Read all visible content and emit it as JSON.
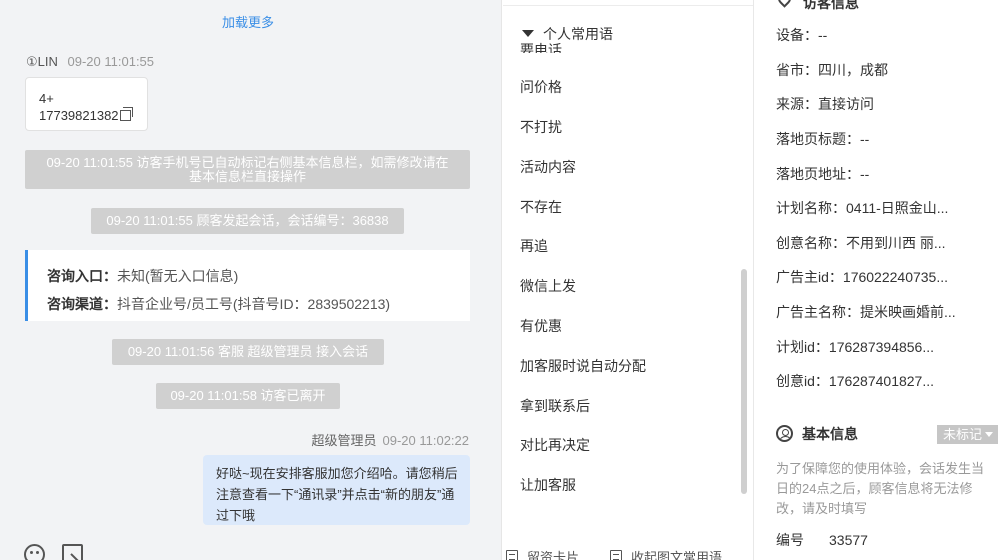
{
  "chat": {
    "load_more": "加载更多",
    "visitor_name": "①LIN",
    "visitor_time": "09-20 11:01:55",
    "phone_line1": "4+",
    "phone_line2": "17739821382",
    "sys_phone_line1": "09-20 11:01:55 访客手机号已自动标记右侧基本信息栏，如需修改请在",
    "sys_phone_line2": "基本信息栏直接操作",
    "sys_start": "09-20 11:01:55 顾客发起会话，会话编号：36838",
    "entry_label": "咨询入口：",
    "entry_value": "未知(暂无入口信息)",
    "channel_label": "咨询渠道：",
    "channel_value": "抖音企业号/员工号(抖音号ID：2839502213)",
    "sys_agent": "09-20 11:01:56 客服 超级管理员 接入会话",
    "sys_left": "09-20 11:01:58 访客已离开",
    "agent_name": "超级管理员",
    "agent_time": "09-20 11:02:22",
    "agent_message": "好哒~现在安排客服加您介绍哈。请您稍后注意查看一下“通讯录”并点击“新的朋友”通过下哦"
  },
  "phrases": {
    "clipped_item": "要电话",
    "group_title": "个人常用语",
    "items": [
      "问价格",
      "不打扰",
      "活动内容",
      "不存在",
      "再追",
      "微信上发",
      "有优惠",
      "加客服时说自动分配",
      "拿到联系后",
      "对比再决定",
      "让加客服"
    ],
    "tab_card": "留资卡片",
    "tab_richtext": "收起图文常用语"
  },
  "info": {
    "cut_title": "访客信息",
    "rows": [
      {
        "label": "设备：",
        "value": "--"
      },
      {
        "label": "省市：",
        "value": "四川，成都"
      },
      {
        "label": "来源：",
        "value": "直接访问"
      },
      {
        "label": "落地页标题：",
        "value": "--"
      },
      {
        "label": "落地页地址：",
        "value": "--"
      },
      {
        "label": "计划名称：",
        "value": "0411-日照金山..."
      },
      {
        "label": "创意名称：",
        "value": "不用到川西 丽..."
      },
      {
        "label": "广告主id：",
        "value": "176022240735..."
      },
      {
        "label": "广告主名称：",
        "value": "提米映画婚前..."
      },
      {
        "label": "计划id：",
        "value": "176287394856..."
      },
      {
        "label": "创意id：",
        "value": "176287401827..."
      }
    ],
    "basic_title": "基本信息",
    "mark_select": "未标记",
    "notice": "为了保障您的使用体验，会话发生当日的24点之后，顾客信息将无法修改，请及时填写",
    "serial_label": "编号",
    "serial_value": "33577"
  }
}
